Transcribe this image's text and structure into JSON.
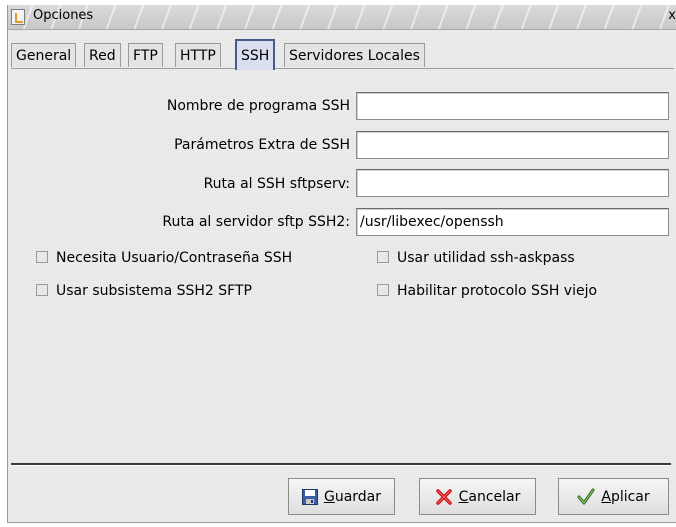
{
  "window": {
    "title": "Opciones",
    "close_glyph": "x"
  },
  "tabs": [
    {
      "label": "General",
      "active": false
    },
    {
      "label": "Red",
      "active": false
    },
    {
      "label": "FTP",
      "active": false
    },
    {
      "label": "HTTP",
      "active": false
    },
    {
      "label": "SSH",
      "active": true
    },
    {
      "label": "Servidores Locales",
      "active": false
    }
  ],
  "form": {
    "ssh_program": {
      "label": "Nombre de programa SSH",
      "value": ""
    },
    "ssh_extra": {
      "label": "Parámetros Extra de SSH",
      "value": ""
    },
    "sftpserv_path": {
      "label": "Ruta al SSH sftpserv:",
      "value": ""
    },
    "ssh2_sftp_path": {
      "label": "Ruta al servidor sftp SSH2:",
      "value": "/usr/libexec/openssh"
    }
  },
  "checkboxes": {
    "need_user_pass": {
      "label": "Necesita Usuario/Contraseña SSH",
      "checked": false
    },
    "use_askpass": {
      "label": "Usar utilidad ssh-askpass",
      "checked": false
    },
    "use_ssh2_subsystem": {
      "label": "Usar subsistema SSH2 SFTP",
      "checked": false
    },
    "enable_old_protocol": {
      "label": "Habilitar protocolo SSH viejo",
      "checked": false
    }
  },
  "buttons": {
    "save": {
      "label_mnemonic": "G",
      "label_rest": "uardar",
      "icon": "floppy-disk-icon"
    },
    "cancel": {
      "label_mnemonic": "C",
      "label_rest": "ancelar",
      "icon": "red-x-icon"
    },
    "apply": {
      "label_mnemonic": "A",
      "label_rest": "plicar",
      "icon": "checkmark-icon"
    }
  },
  "colors": {
    "active_tab_border": "#4a5a8a",
    "active_tab_bg": "#d9dff0",
    "cancel_icon": "#cc1111",
    "apply_icon": "#2a6a1a",
    "save_icon": "#3a5fa8"
  }
}
